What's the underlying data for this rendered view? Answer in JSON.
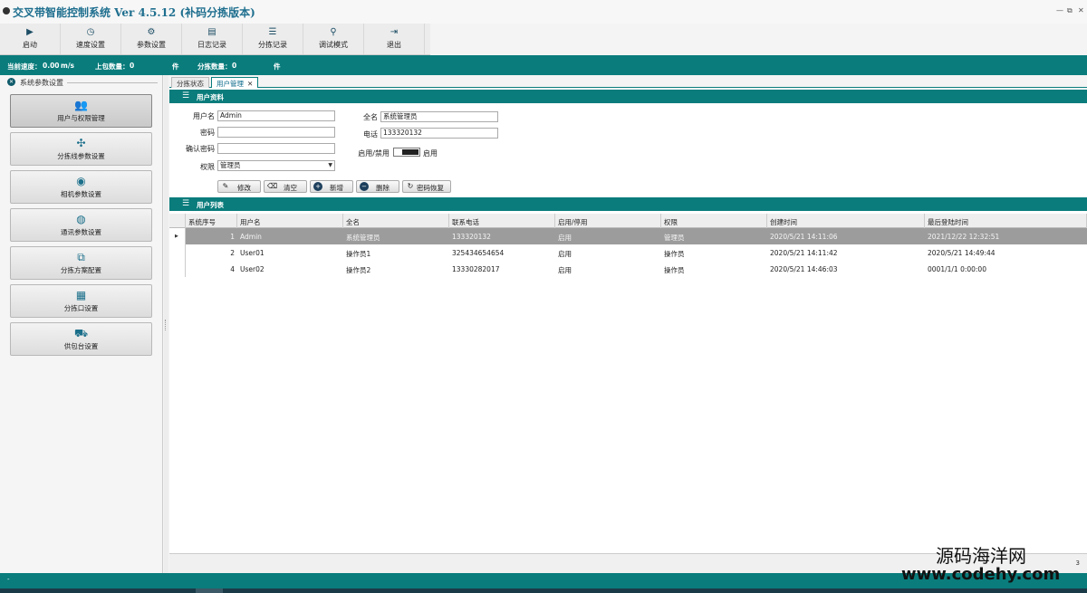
{
  "window": {
    "title": "交叉带智能控制系统 Ver 4.5.12 (补码分拣版本)",
    "controls": [
      "—",
      "⧉",
      "✕"
    ]
  },
  "toolbar": [
    {
      "label": "启动",
      "icon": "play-icon",
      "glyph": "▶"
    },
    {
      "label": "速度设置",
      "icon": "gauge-icon",
      "glyph": "◷"
    },
    {
      "label": "参数设置",
      "icon": "param-icon",
      "glyph": "⚙"
    },
    {
      "label": "日志记录",
      "icon": "printer-icon",
      "glyph": "▤"
    },
    {
      "label": "分拣记录",
      "icon": "database-icon",
      "glyph": "☰"
    },
    {
      "label": "调试模式",
      "icon": "debug-icon",
      "glyph": "⚲"
    },
    {
      "label": "退出",
      "icon": "exit-icon",
      "glyph": "⇥"
    }
  ],
  "status": {
    "speed_label": "当前速度：",
    "speed_value": "0.00",
    "speed_unit": "m/s",
    "loaded_label": "上包数量：",
    "loaded_value": "0",
    "loaded_unit": "件",
    "sorted_label": "分拣数量：",
    "sorted_value": "0",
    "sorted_unit": "件"
  },
  "sidebar": {
    "title": "系统参数设置",
    "items": [
      {
        "label": "用户与权限管理",
        "icon": "users-icon",
        "glyph": "👥"
      },
      {
        "label": "分拣线参数设置",
        "icon": "network-icon",
        "glyph": "✣"
      },
      {
        "label": "相机参数设置",
        "icon": "camera-icon",
        "glyph": "◉"
      },
      {
        "label": "通讯参数设置",
        "icon": "globe-icon",
        "glyph": "◍"
      },
      {
        "label": "分拣方案配置",
        "icon": "scheme-icon",
        "glyph": "⧉"
      },
      {
        "label": "分拣口设置",
        "icon": "grid-icon",
        "glyph": "▦"
      },
      {
        "label": "供包台设置",
        "icon": "package-icon",
        "glyph": "⛟"
      }
    ]
  },
  "tabs": [
    {
      "label": "分拣状态"
    },
    {
      "label": "用户管理",
      "close": "✕"
    }
  ],
  "user_form": {
    "section_title": "用户资料",
    "username_label": "用户名",
    "username_value": "Admin",
    "password_label": "密码",
    "password_value": "",
    "confirm_label": "确认密码",
    "confirm_value": "",
    "role_label": "权限",
    "role_value": "管理员",
    "fullname_label": "全名",
    "fullname_value": "系统管理员",
    "phone_label": "电话",
    "phone_value": "133320132",
    "enable_label": "启用/禁用",
    "enable_state": "启用",
    "buttons": {
      "modify": "修改",
      "clear": "清空",
      "add": "新增",
      "delete": "删除",
      "reset_pw": "密码恢复"
    }
  },
  "user_list": {
    "section_title": "用户列表",
    "columns": [
      "系统序号",
      "用户名",
      "全名",
      "联系电话",
      "启用/停用",
      "权限",
      "创建时间",
      "最后登陆时间"
    ],
    "rows": [
      [
        "1",
        "Admin",
        "系统管理员",
        "133320132",
        "启用",
        "管理员",
        "2020/5/21 14:11:06",
        "2021/12/22 12:32:51"
      ],
      [
        "2",
        "User01",
        "操作员1",
        "325434654654",
        "启用",
        "操作员",
        "2020/5/21 14:11:42",
        "2020/5/21 14:49:44"
      ],
      [
        "4",
        "User02",
        "操作员2",
        "13330282017",
        "启用",
        "操作员",
        "2020/5/21 14:46:03",
        "0001/1/1 0:00:00"
      ]
    ],
    "page_number": "3"
  },
  "watermark": {
    "line1": "源码海洋网",
    "line2": "www.codehy.com"
  }
}
